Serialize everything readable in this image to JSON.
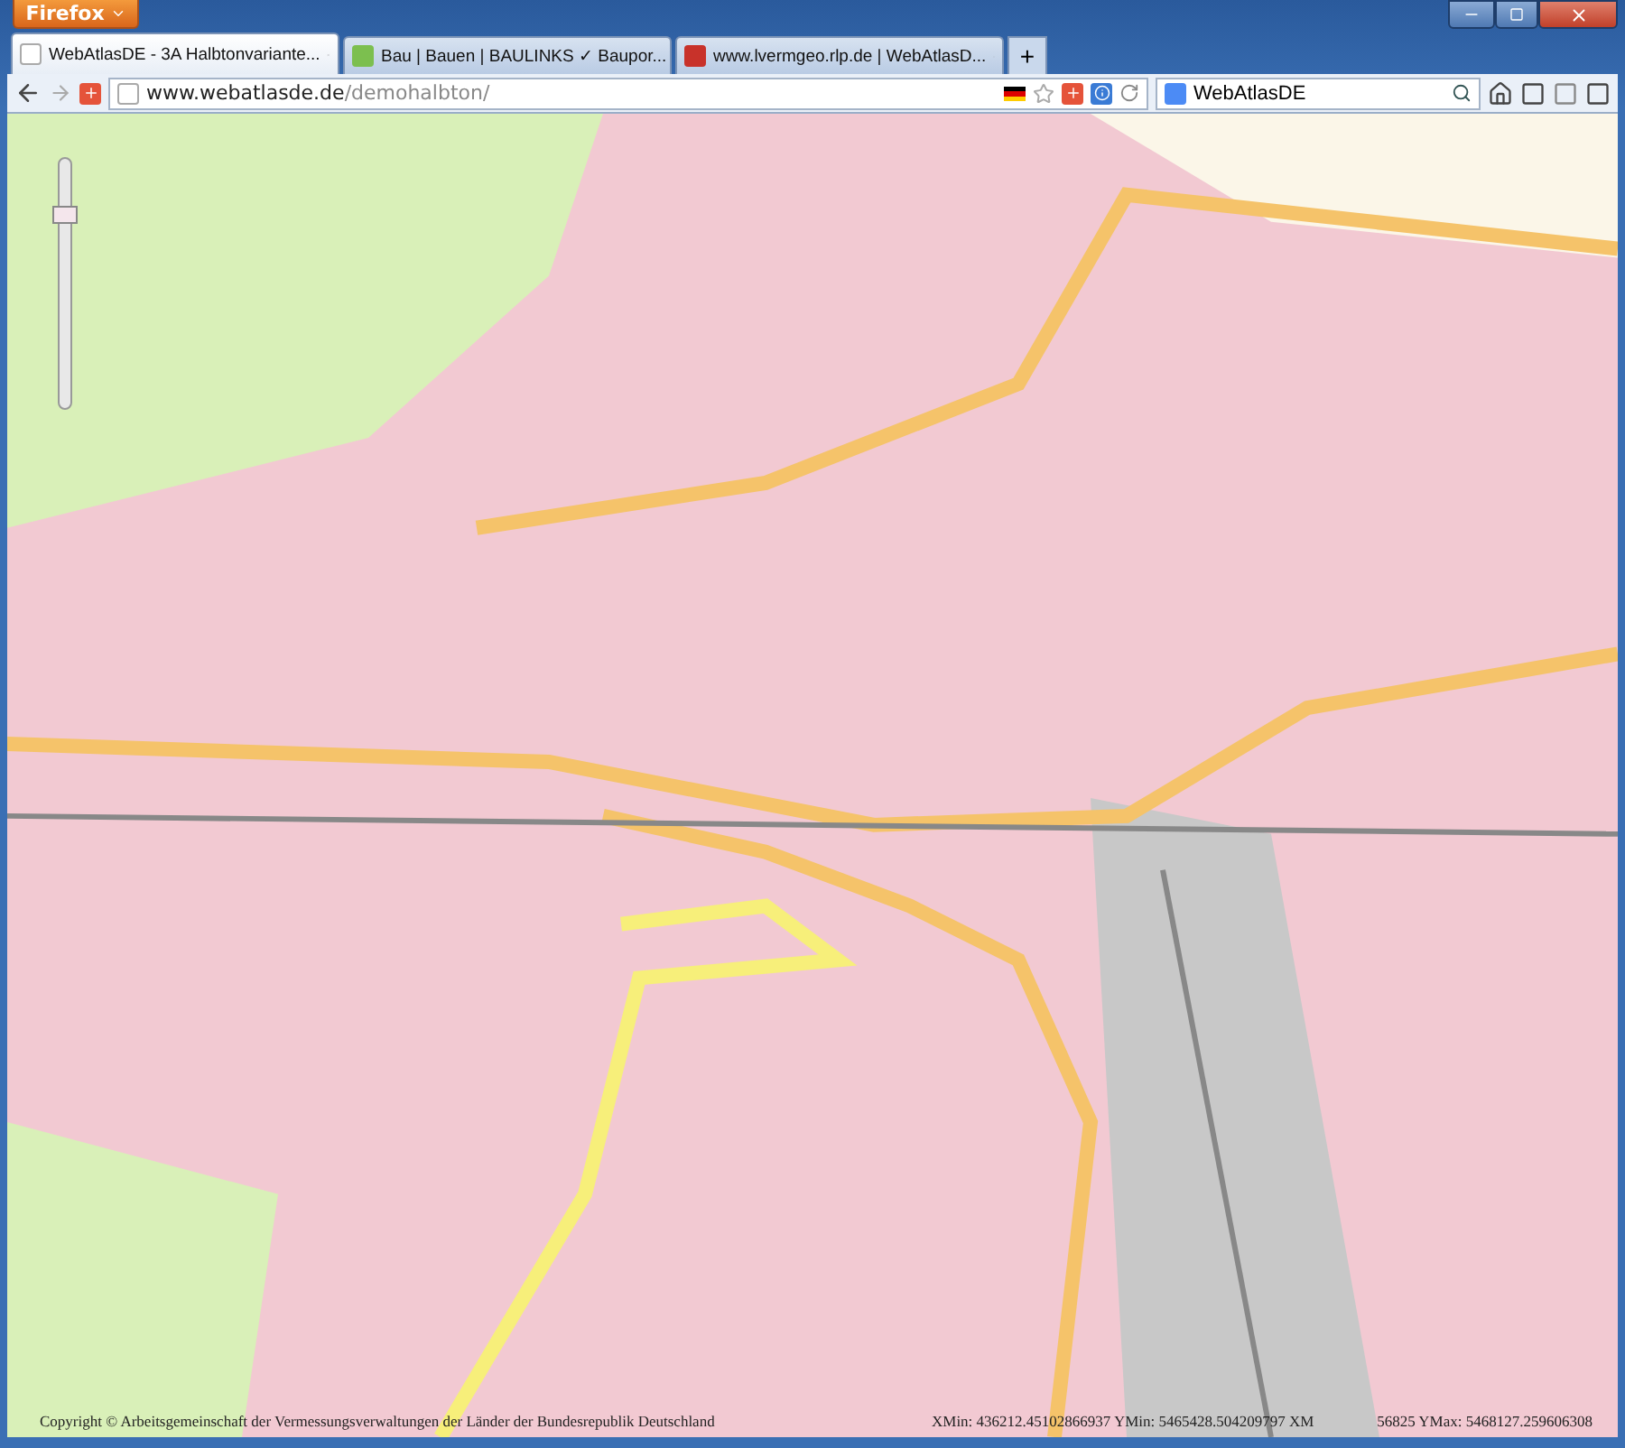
{
  "window": {
    "app_button": "Firefox"
  },
  "tabs": [
    {
      "title": "WebAtlasDE - 3A Halbtonvariante...",
      "selected": true
    },
    {
      "title": "Bau | Bauen | BAULINKS ✓ Baupor...",
      "selected": false
    },
    {
      "title": "www.lvermgeo.rlp.de | WebAtlasD...",
      "selected": false
    }
  ],
  "new_tab": "+",
  "address": {
    "host": "www.webatlasde.de",
    "path": "/demohalbton/"
  },
  "search": {
    "value": "WebAtlasDE"
  },
  "map": {
    "zoom": {
      "level": 0.8
    },
    "copyright": "Copyright © Arbeitsgemeinschaft der Vermessungsverwaltungen der Länder der Bundesrepublik Deutschland",
    "extent_start": "XMin: 436212.45102866937 YMin: 5465428.504209797 XM",
    "extent_end": "56825 YMax: 5468127.259606308"
  }
}
